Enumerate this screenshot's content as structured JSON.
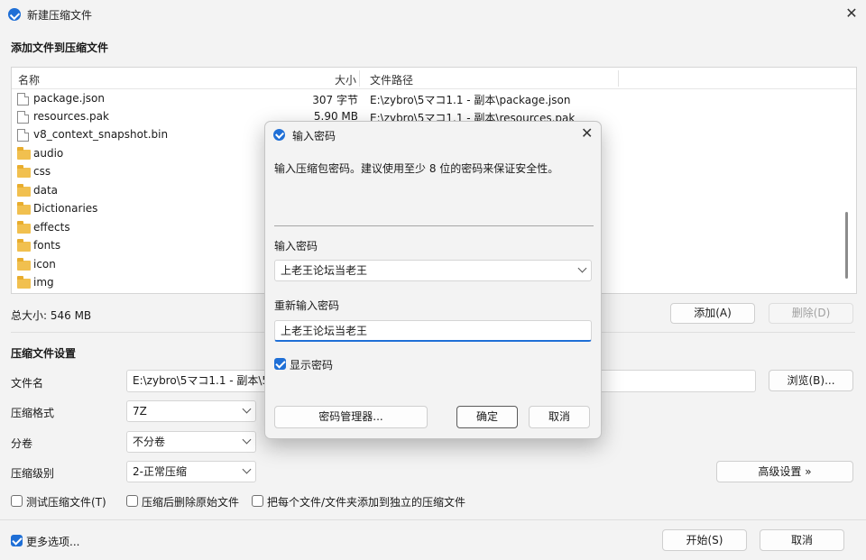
{
  "window": {
    "title": "新建压缩文件"
  },
  "files_section": {
    "title": "添加文件到压缩文件"
  },
  "file_list": {
    "columns": {
      "name": "名称",
      "size": "大小",
      "path": "文件路径"
    },
    "rows": [
      {
        "type": "file",
        "name": "package.json",
        "size": "307 字节",
        "path": "E:\\zybro\\5マコ1.1 - 副本\\package.json"
      },
      {
        "type": "file",
        "name": "resources.pak",
        "size": "5.90 MB",
        "path": "E:\\zybro\\5マコ1.1 - 副本\\resources.pak"
      },
      {
        "type": "file",
        "name": "v8_context_snapshot.bin",
        "size": "",
        "path": ""
      },
      {
        "type": "folder",
        "name": "audio",
        "size": "",
        "path": ""
      },
      {
        "type": "folder",
        "name": "css",
        "size": "",
        "path": ""
      },
      {
        "type": "folder",
        "name": "data",
        "size": "",
        "path": ""
      },
      {
        "type": "folder",
        "name": "Dictionaries",
        "size": "",
        "path": ""
      },
      {
        "type": "folder",
        "name": "effects",
        "size": "",
        "path": ""
      },
      {
        "type": "folder",
        "name": "fonts",
        "size": "",
        "path": ""
      },
      {
        "type": "folder",
        "name": "icon",
        "size": "",
        "path": ""
      },
      {
        "type": "folder",
        "name": "img",
        "size": "",
        "path": ""
      }
    ]
  },
  "summary": {
    "total_size": "总大小: 546 MB"
  },
  "buttons": {
    "add": "添加(A)",
    "delete": "删除(D)",
    "browse": "浏览(B)...",
    "advanced": "高级设置 »",
    "start": "开始(S)",
    "cancel": "取消"
  },
  "settings": {
    "title": "压缩文件设置",
    "filename_label": "文件名",
    "filename_value": "E:\\zybro\\5マコ1.1 - 副本\\5ᵀ",
    "format_label": "压缩格式",
    "format_value": "7Z",
    "split_label": "分卷",
    "split_value": "不分卷",
    "level_label": "压缩级别",
    "level_value": "2-正常压缩"
  },
  "options": {
    "test": "测试压缩文件(T)",
    "delete_source": "压缩后删除原始文件",
    "separate": "把每个文件/文件夹添加到独立的压缩文件",
    "more": "更多选项..."
  },
  "dialog": {
    "title": "输入密码",
    "description": "输入压缩包密码。建议使用至少 8 位的密码来保证安全性。",
    "password_label": "输入密码",
    "password_value": "上老王论坛当老王",
    "repeat_label": "重新输入密码",
    "repeat_value": "上老王论坛当老王",
    "show_password": "显示密码",
    "manager_button": "密码管理器...",
    "ok_button": "确定",
    "cancel_button": "取消"
  },
  "colors": {
    "accent": "#1f6fd6"
  }
}
